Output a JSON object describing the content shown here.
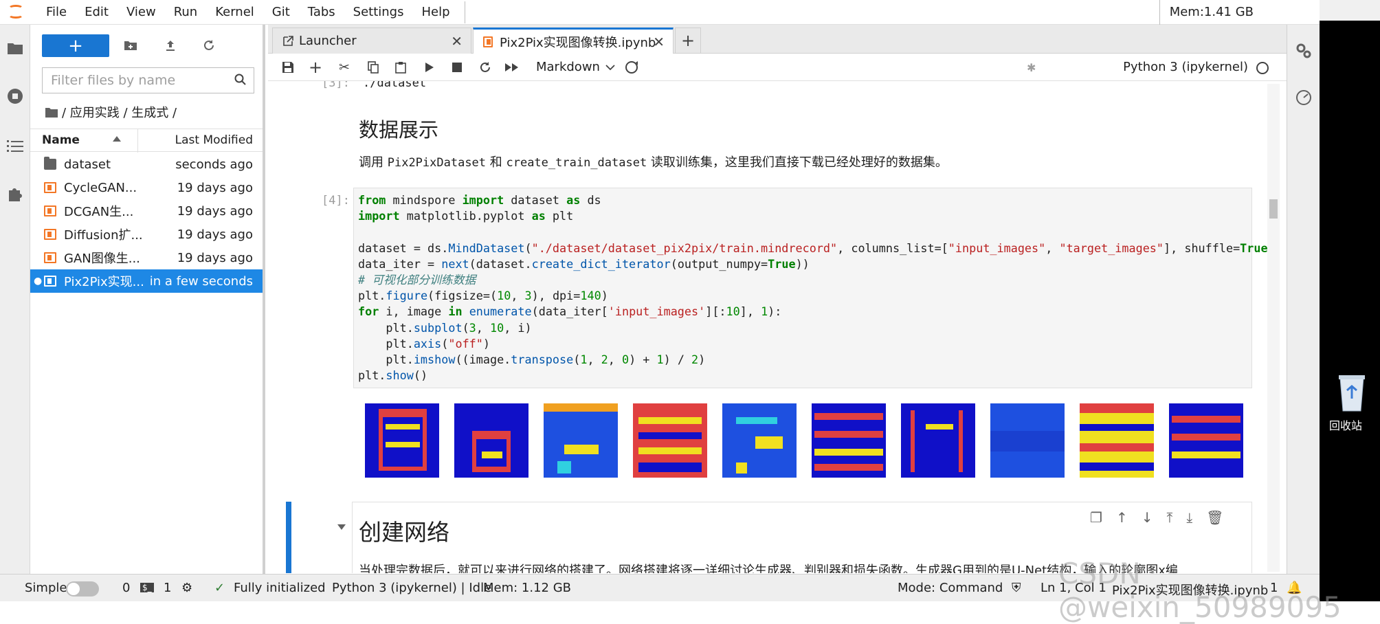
{
  "menubar": {
    "items": [
      "File",
      "Edit",
      "View",
      "Run",
      "Kernel",
      "Git",
      "Tabs",
      "Settings",
      "Help"
    ],
    "memory": "Mem:1.41 GB"
  },
  "filebrowser": {
    "new_label": "+",
    "filter_placeholder": "Filter files by name",
    "breadcrumb": "/ 应用实践 / 生成式 /",
    "col_name": "Name",
    "col_modified": "Last Modified",
    "files": [
      {
        "name": "dataset",
        "modified": "seconds ago",
        "type": "folder"
      },
      {
        "name": "CycleGAN...",
        "modified": "19 days ago",
        "type": "notebook"
      },
      {
        "name": "DCGAN生...",
        "modified": "19 days ago",
        "type": "notebook"
      },
      {
        "name": "Diffusion扩...",
        "modified": "19 days ago",
        "type": "notebook"
      },
      {
        "name": "GAN图像生...",
        "modified": "19 days ago",
        "type": "notebook"
      },
      {
        "name": "Pix2Pix实现...",
        "modified": "in a few seconds",
        "type": "notebook",
        "selected": true
      }
    ]
  },
  "tabs": [
    {
      "label": "Launcher",
      "active": false
    },
    {
      "label": "Pix2Pix实现图像转换.ipynb",
      "active": true
    }
  ],
  "toolbar": {
    "cell_type": "Markdown",
    "kernel": "Python 3 (ipykernel)"
  },
  "notebook": {
    "prev_prompt": "[3]:",
    "prev_output": "./dataset",
    "heading1": "数据展示",
    "para1_pre": "调用 ",
    "para1_code1": "Pix2PixDataset",
    "para1_mid": " 和 ",
    "para1_code2": "create_train_dataset",
    "para1_post": " 读取训练集，这里我们直接下载已经处理好的数据集。",
    "code_prompt": "[4]:",
    "heading2": "创建网络",
    "para2": "当处理完数据后，就可以来进行网络的搭建了。网络搭建将逐一详细讨论生成器、判别器和损失函数。生成器G用到的是U-Net结构，输入的轮廓图x编"
  },
  "statusbar": {
    "mode": "Simple",
    "terminals": "0",
    "kernels": "1",
    "init": "Fully initialized",
    "kernel_status": "Python 3 (ipykernel) | Idle",
    "mem": "Mem: 1.12 GB",
    "cmd_mode": "Mode: Command",
    "position": "Ln 1, Col 1",
    "filename": "Pix2Pix实现图像转换.ipynb",
    "count": "1"
  },
  "desktop": {
    "recycle_label": "回收站"
  },
  "watermark": "CSDN @weixin_50989095",
  "colors": {
    "accent": "#1976d2",
    "selected": "#1e88e5",
    "orange": "#f37726"
  }
}
